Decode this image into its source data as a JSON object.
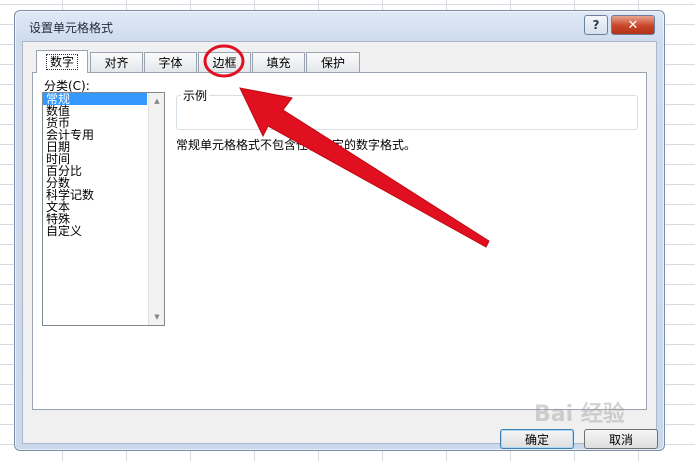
{
  "dialog": {
    "title": "设置单元格格式",
    "help_label": "?",
    "close_label": "✕"
  },
  "tabs": [
    {
      "label": "数字",
      "active": true
    },
    {
      "label": "对齐",
      "active": false
    },
    {
      "label": "字体",
      "active": false
    },
    {
      "label": "边框",
      "active": false
    },
    {
      "label": "填充",
      "active": false
    },
    {
      "label": "保护",
      "active": false
    }
  ],
  "category": {
    "label": "分类(C):",
    "items": [
      "常规",
      "数值",
      "货币",
      "会计专用",
      "日期",
      "时间",
      "百分比",
      "分数",
      "科学记数",
      "文本",
      "特殊",
      "自定义"
    ],
    "selected": "常规"
  },
  "sample": {
    "label": "示例"
  },
  "description": "常规单元格格式不包含任何特定的数字格式。",
  "buttons": {
    "ok": "确定",
    "cancel": "取消"
  },
  "watermark": "Bai 经验",
  "colors": {
    "annotation": "#e01020",
    "selection": "#3399ff"
  }
}
